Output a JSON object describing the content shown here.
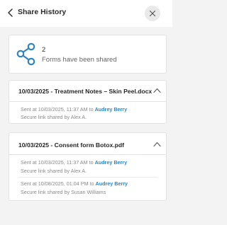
{
  "header": {
    "title": "Share History",
    "back_icon": "chevron-left-icon",
    "close_icon": "close-icon"
  },
  "summary": {
    "count": "2",
    "label": "Forms have been shared",
    "icon": "share-icon",
    "icon_color": "#2e86c1"
  },
  "documents": [
    {
      "title": "10/03/2025 - Treatment Notes – Skin Peel.docx",
      "expanded": true,
      "shares": [
        {
          "sent_prefix": "Sent at 10/03/2025, 11:37 AM to ",
          "recipient": "Audrey Berry",
          "shared_by": "Secure link shared by Alex A."
        }
      ]
    },
    {
      "title": "10/03/2025 - Consent form Botox.pdf",
      "expanded": true,
      "shares": [
        {
          "sent_prefix": "Sent at 10/03/2025, 11:37 AM to ",
          "recipient": "Audrey Berry",
          "shared_by": "Secure link shared by Alex A."
        },
        {
          "sent_prefix": "Sent at 10/08/2025, 01:04 PM to ",
          "recipient": "Audrey Berry",
          "shared_by": "Secure link shared by Susan Williams"
        }
      ]
    }
  ],
  "colors": {
    "accent": "#2e86c1",
    "background": "#f3f3f4"
  }
}
